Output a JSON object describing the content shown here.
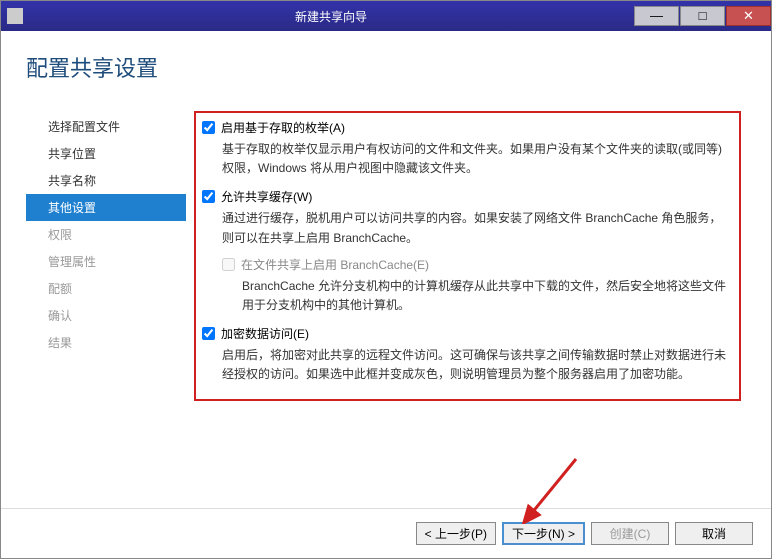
{
  "titlebar": {
    "title": "新建共享向导"
  },
  "heading": "配置共享设置",
  "sidebar": {
    "items": [
      {
        "label": "选择配置文件",
        "state": "normal"
      },
      {
        "label": "共享位置",
        "state": "normal"
      },
      {
        "label": "共享名称",
        "state": "normal"
      },
      {
        "label": "其他设置",
        "state": "selected"
      },
      {
        "label": "权限",
        "state": "disabled"
      },
      {
        "label": "管理属性",
        "state": "disabled"
      },
      {
        "label": "配额",
        "state": "disabled"
      },
      {
        "label": "确认",
        "state": "disabled"
      },
      {
        "label": "结果",
        "state": "disabled"
      }
    ]
  },
  "options": {
    "enum": {
      "label": "启用基于存取的枚举(A)",
      "desc": "基于存取的枚举仅显示用户有权访问的文件和文件夹。如果用户没有某个文件夹的读取(或同等)权限，Windows 将从用户视图中隐藏该文件夹。",
      "checked": true
    },
    "cache": {
      "label": "允许共享缓存(W)",
      "desc": "通过进行缓存，脱机用户可以访问共享的内容。如果安装了网络文件 BranchCache 角色服务，则可以在共享上启用 BranchCache。",
      "checked": true,
      "sub": {
        "label": "在文件共享上启用 BranchCache(E)",
        "desc": "BranchCache 允许分支机构中的计算机缓存从此共享中下载的文件，然后安全地将这些文件用于分支机构中的其他计算机。",
        "checked": false
      }
    },
    "encrypt": {
      "label": "加密数据访问(E)",
      "desc": "启用后，将加密对此共享的远程文件访问。这可确保与该共享之间传输数据时禁止对数据进行未经授权的访问。如果选中此框并变成灰色，则说明管理员为整个服务器启用了加密功能。",
      "checked": true
    }
  },
  "footer": {
    "prev": "< 上一步(P)",
    "next": "下一步(N) >",
    "create": "创建(C)",
    "cancel": "取消"
  }
}
